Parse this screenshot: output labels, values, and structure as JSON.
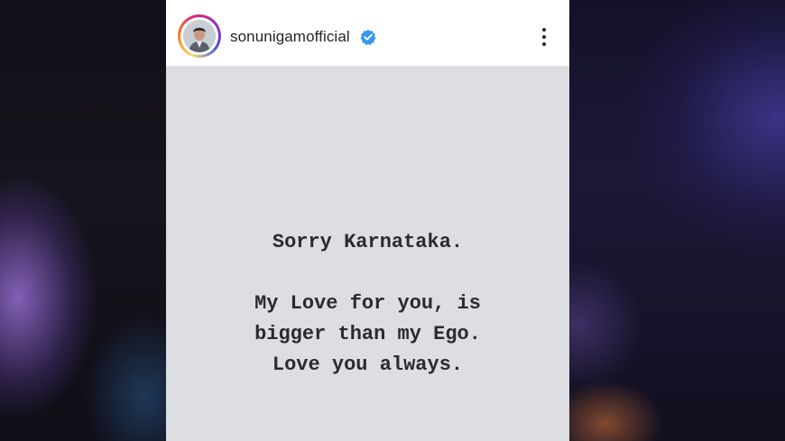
{
  "post": {
    "username": "sonunigamofficial",
    "verified": true,
    "avatar": "profile-photo",
    "menu_icon": "more-vertical-icon",
    "message": {
      "line1": "Sorry Karnataka.",
      "line2": "My Love for you, is",
      "line3": "bigger than my Ego.",
      "line4": "Love you always."
    }
  },
  "colors": {
    "post_background": "#dcdee2",
    "header_background": "#ffffff",
    "verified_badge": "#3897f0",
    "text": "#2b2b2b"
  }
}
